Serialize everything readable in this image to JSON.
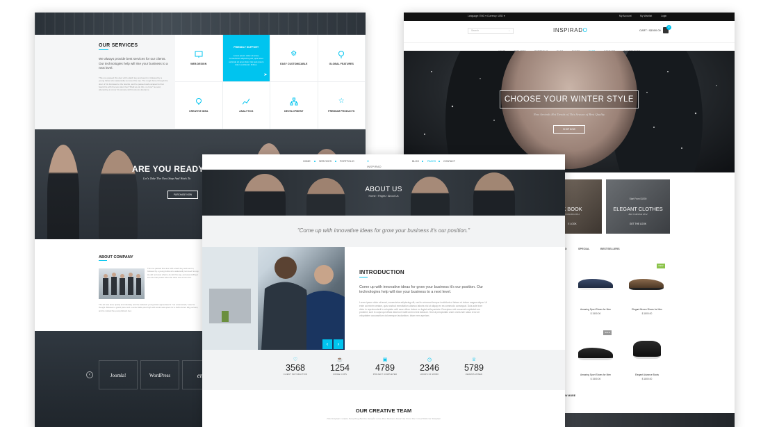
{
  "left": {
    "services": {
      "title": "OUR SERVICES",
      "lead": "We always provide best services for our clients. Our technologies help will rise your business to a next level.",
      "body": "This one passed this door with a latch key and went in, followed by a young fellow who awkwardly removed his cap. The rough burry through the door of his forehead to the boards, and he passed and escaped to that heard his with the two silent had \"Shall we do this, no how\" he said, attempting to cover his anxiety with boorious utterance.",
      "cells": [
        {
          "label": "WEB DESIGN",
          "icon": "monitor-icon"
        },
        {
          "label": "FRIENDLY SUPPORT",
          "icon": "support-icon",
          "text": "Lorem ipsum dolor sit amet, consectetur adipiscing elit, quis amet vehicula sit amet dolor nisi quis ipsum dolor vestibulum finibus."
        },
        {
          "label": "EASY CUSTOMIZABLE",
          "icon": "gear-icon"
        },
        {
          "label": "GLOBAL FEATURES",
          "icon": "bulb-icon"
        },
        {
          "label": "CREATIVE IDEA",
          "icon": "lightbulb-icon"
        },
        {
          "label": "ANALYTICS",
          "icon": "analytics-icon"
        },
        {
          "label": "DEVELOPMENT",
          "icon": "sitemap-icon"
        },
        {
          "label": "PREMIUM PRODUCTS",
          "icon": "star-icon"
        }
      ]
    },
    "ready": {
      "title": "ARE YOU READY T",
      "subtitle": "Let's Take The Next Step And Work To",
      "button": "PURCHASE NOW"
    },
    "about_company": {
      "title": "ABOUT COMPANY",
      "text1": "The one passed this door with a latch key and went in, followed by a young fellow who awkwardly removed his cap. He did not know what to do with his cap, and was stuffing it into his coat pocket when the other took it from him.",
      "text2": "The act was done quietly and naturally, and the awkward young fellow appreciated it. \"He understands,\" was his thought. Between a grand piano and a center table piled high with books was space for a half a dozen fully persons, and he noticed the young fellow's feet."
    },
    "brands": [
      "Joomla!",
      "WordPress",
      "env"
    ]
  },
  "right": {
    "topbar": {
      "language": "Language: ENG ▾",
      "currency": "Currency: USD ▾",
      "account": "My Account",
      "wishlist": "My Wishlist",
      "login": "Login"
    },
    "search_placeholder": "Search",
    "logo_text": "INSPIRAD",
    "logo_accent": "O",
    "cart": "CART / $1500.00",
    "cart_count": "0",
    "nav": [
      "HOME",
      "SERVICES",
      "PORTFOLIO",
      "BLOG",
      "PAGES",
      "SHOP",
      "CONTACT",
      "SHORTCODES"
    ],
    "hero": {
      "title": "CHOOSE YOUR WINTER STYLE",
      "subtitle": "New Arrivals Hot Trends of This Season of Best Quality",
      "button": "SHOP NOW"
    },
    "promos": [
      {
        "kicker": "",
        "title": "K BOOK",
        "sub": "Collection 2014",
        "btn": "E LOOK"
      },
      {
        "kicker": "Start From $1500",
        "title": "ELEGANT CLOTHES",
        "sub": "Men Collection 2014",
        "btn": "GET THE LOOK"
      }
    ],
    "tabs": [
      "D",
      "SPECIAL",
      "BESTSELLERS"
    ],
    "products": [
      {
        "name": "Amazing Sport Shoes for Men",
        "price": "$ 1500.00"
      },
      {
        "name": "Elegant Brown Shoes for Men",
        "price": "$ 1800.00"
      },
      {
        "name": "Amazing Sport Shoes for Men",
        "price": "$ 1500.00"
      },
      {
        "name": "Elegant Advance Boots",
        "price": "$ 1800.00"
      }
    ],
    "new_badge": "NEW",
    "sale_badge": "SALE",
    "more": "W MORE"
  },
  "center": {
    "nav_left": [
      "HOME",
      "SERVICES",
      "PORTFOLIO"
    ],
    "nav_right": [
      "BLOG",
      "PAGES",
      "CONTACT"
    ],
    "logo_text": "INSPIRAD",
    "logo_accent": "O",
    "banner_title": "ABOUT US",
    "breadcrumb": "Home  ›  Pages  ›  About Us",
    "quote": "\"Come up with innovative ideas for grow your business it's our position.\"",
    "intro_title": "INTRODUCTION",
    "intro_lead": "Come up with innovative ideas for grow your business it's our position. Our technologies help will rise your business to a next level.",
    "intro_body": "Lorem ipsum dolor sit amet, consectetur adipiscing elit, sed do eiusmod tempor incididunt ut labore et dolore magna aliqua. Ut enim ad minim veniam, quis nostrud exercitation ullamco laboris nisi ut aliquip ex ea commodo consequat. Duis aute irure dolor in reprehenderit in voluptate velit esse cillum dolore eu fugiat nulla pariatur. Excepteur sint occaecat cupidatat non proident, sunt in culpa qui officia deserunt mollit anim id est laborum. Sed ut perspiciatis unde omnis iste natus error sit voluptatem accusantium doloremque laudantium, totam rem aperiam.",
    "stats": [
      {
        "num": "3568",
        "label": "CLIENT SATISFACTION",
        "icon": "heart-icon"
      },
      {
        "num": "1254",
        "label": "COFEE CUPS",
        "icon": "cup-icon"
      },
      {
        "num": "4789",
        "label": "PROJECT COMPLETED",
        "icon": "briefcase-icon"
      },
      {
        "num": "2346",
        "label": "HOURS OF WORK",
        "icon": "clock-icon"
      },
      {
        "num": "5789",
        "label": "AWARDS WINED",
        "icon": "trophy-icon"
      }
    ],
    "team_title": "OUR CREATIVE TEAM",
    "team_sub": "This Template Contain Everything But You Need for Grow Your Business Stand Out From The Crowd With Our Template"
  }
}
